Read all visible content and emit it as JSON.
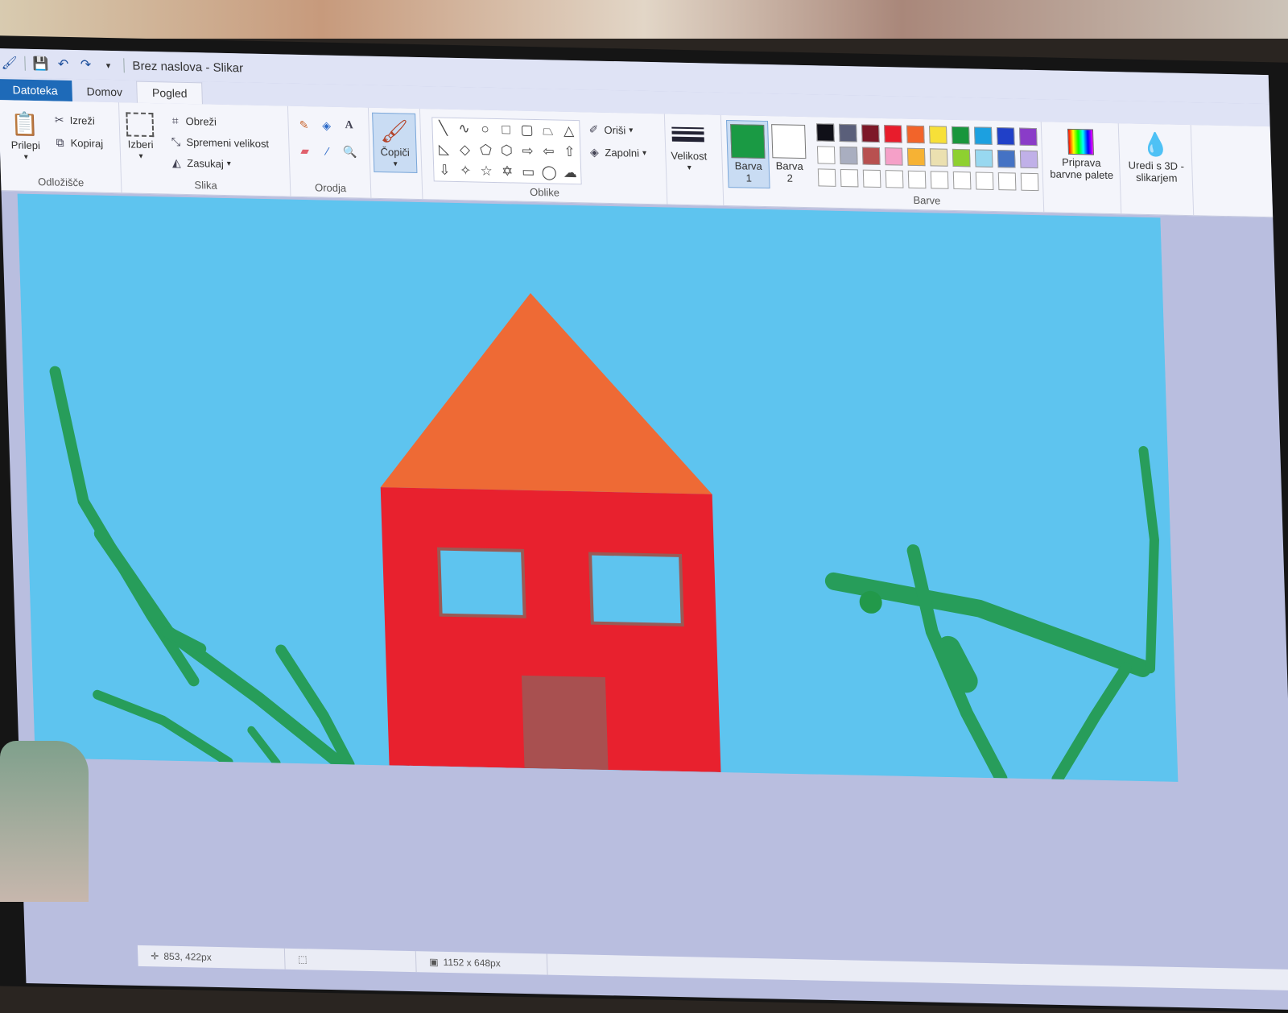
{
  "window": {
    "title": "Brez naslova - Slikar"
  },
  "tabs": [
    "Datoteka",
    "Domov",
    "Pogled"
  ],
  "ribbon": {
    "clipboard": {
      "paste": "Prilepi",
      "cut": "Izreži",
      "copy": "Kopiraj",
      "label": "Odložišče"
    },
    "image": {
      "select": "Izberi",
      "crop": "Obreži",
      "resize": "Spremeni velikost",
      "rotate": "Zasukaj",
      "label": "Slika"
    },
    "tools": {
      "label": "Orodja"
    },
    "brushes": {
      "label": "Čopiči"
    },
    "shapes": {
      "outline": "Oriši",
      "fill": "Zapolni",
      "label": "Oblike"
    },
    "size": {
      "label": "Velikost"
    },
    "colors": {
      "color1_label": "Barva 1",
      "color2_label": "Barva 2",
      "label": "Barve",
      "edit_colors": "Priprava barvne palete",
      "paint3d": "Uredi s 3D -slikarjem",
      "color1": "#1a9a44",
      "color2": "#ffffff",
      "palette": [
        "#101018",
        "#5a5f7a",
        "#7d1828",
        "#e81c2c",
        "#f2642a",
        "#f7e038",
        "#18963c",
        "#1ca0e0",
        "#2040c8",
        "#8a3cc8",
        "#ffffff",
        "#a9aec0",
        "#b85050",
        "#f5a0c8",
        "#f6b234",
        "#ebe0b0",
        "#8ed030",
        "#98d8f0",
        "#4472c4",
        "#c0b0e8",
        "#ffffff",
        "#ffffff",
        "#ffffff",
        "#ffffff",
        "#ffffff",
        "#ffffff",
        "#ffffff",
        "#ffffff",
        "#ffffff",
        "#ffffff"
      ]
    }
  },
  "canvas": {
    "sky": "#5ec4ef",
    "roof": "#ee6a35",
    "wall": "#e8212e",
    "window_fill": "#5ec4ef",
    "window_frame": "#9a5a55",
    "door": "#a85050",
    "grass": "#22994a"
  },
  "status": {
    "cursor": "853, 422px",
    "dimensions": "1152 x 648px"
  }
}
